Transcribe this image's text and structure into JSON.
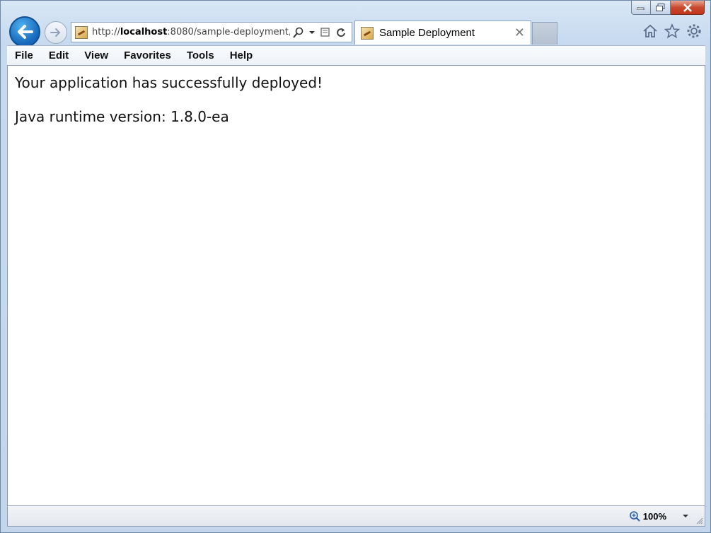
{
  "browser": {
    "address_url_host": "http://",
    "address_url_bold": "localhost",
    "address_url_rest": ":8080/sample-deployment,",
    "tab_title": "Sample Deployment",
    "tab_close": "✕",
    "zoom_level": "100%"
  },
  "menu": {
    "items": [
      "File",
      "Edit",
      "View",
      "Favorites",
      "Tools",
      "Help"
    ]
  },
  "page": {
    "line1": "Your application has successfully deployed!",
    "line2": "Java runtime version: 1.8.0-ea"
  },
  "icons": [
    "back-arrow-icon",
    "forward-arrow-icon",
    "site-favicon",
    "search-icon",
    "dropdown-icon",
    "compatibility-icon",
    "refresh-icon",
    "home-icon",
    "favorites-star-icon",
    "settings-gear-icon",
    "zoom-icon"
  ],
  "colors": {
    "accent": "#1565b8",
    "close_button": "#c94a30"
  }
}
